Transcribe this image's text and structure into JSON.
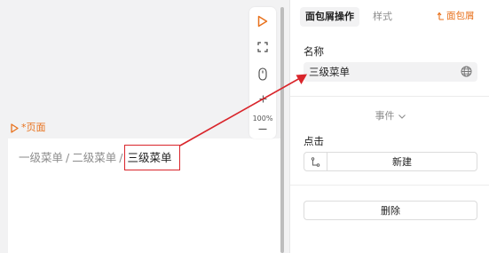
{
  "canvas": {
    "page_tag": "*页面",
    "breadcrumb": {
      "items": [
        "一级菜单",
        "二级菜单",
        "三级菜单"
      ],
      "separator": "/"
    },
    "zoom_level": "100%"
  },
  "panel": {
    "tabs": {
      "active": "面包屑操作",
      "inactive": "样式"
    },
    "component_link": "面包屑",
    "name": {
      "label": "名称",
      "value": "三级菜单"
    },
    "events_toggle": "事件",
    "click": {
      "label": "点击",
      "new_button": "新建"
    },
    "delete_button": "删除"
  },
  "colors": {
    "accent": "#e8711c",
    "highlight": "#d9252b",
    "annotation_arrow": "#d9252b"
  }
}
